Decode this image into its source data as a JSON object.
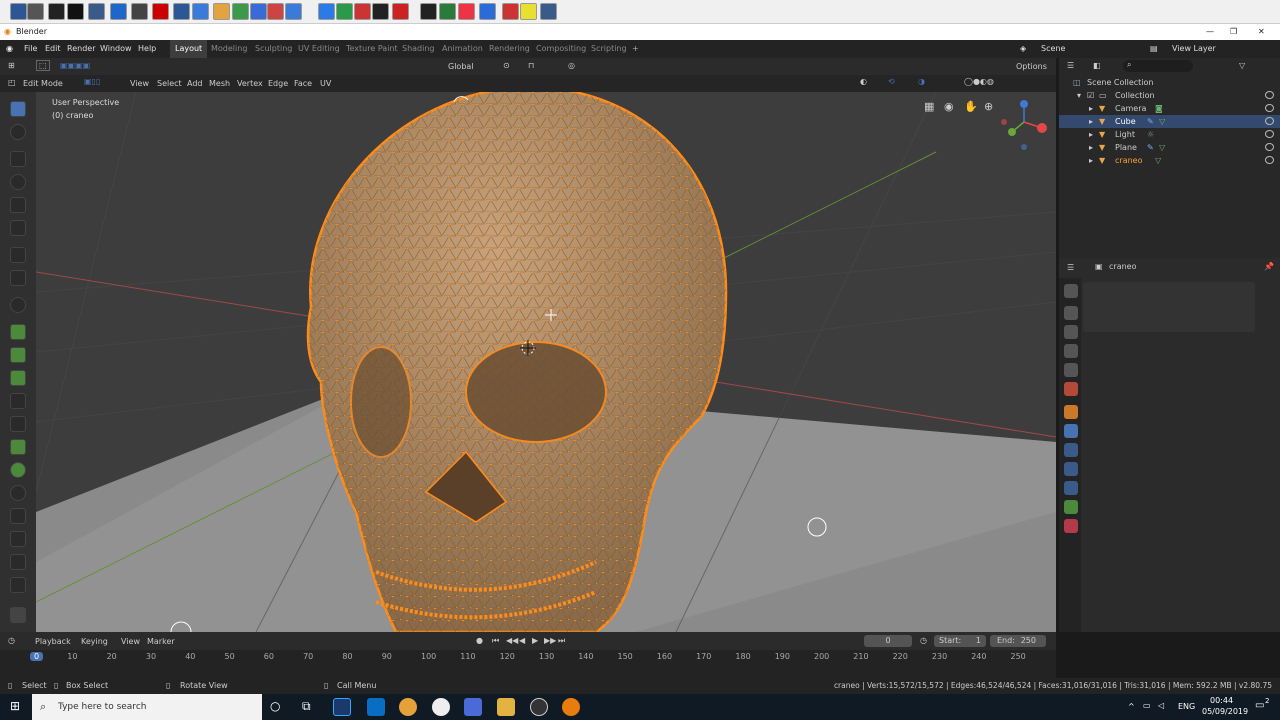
{
  "app": {
    "title": "Blender"
  },
  "menus": [
    "File",
    "Edit",
    "Render",
    "Window",
    "Help"
  ],
  "workspaces": [
    "Layout",
    "Modeling",
    "Sculpting",
    "UV Editing",
    "Texture Paint",
    "Shading",
    "Animation",
    "Rendering",
    "Compositing",
    "Scripting"
  ],
  "header": {
    "scene": "Scene",
    "view_layer": "View Layer",
    "transform": "Global",
    "options": "Options"
  },
  "viewport": {
    "mode": "Edit Mode",
    "menu": [
      "View",
      "Select",
      "Add",
      "Mesh",
      "Vertex",
      "Edge",
      "Face",
      "UV"
    ],
    "overlay_line1": "User Perspective",
    "overlay_line2": "(0) craneo"
  },
  "outliner": {
    "root": "Scene Collection",
    "collection": "Collection",
    "items": [
      {
        "label": "Camera",
        "selected": false,
        "active": false
      },
      {
        "label": "Cube",
        "selected": true,
        "active": false
      },
      {
        "label": "Light",
        "selected": false,
        "active": false
      },
      {
        "label": "Plane",
        "selected": false,
        "active": false
      },
      {
        "label": "craneo",
        "selected": false,
        "active": true
      }
    ]
  },
  "properties": {
    "object_name": "craneo"
  },
  "timeline": {
    "menu": [
      "Playback",
      "Keying",
      "View",
      "Marker"
    ],
    "current_frame": "0",
    "start_label": "Start:",
    "start": "1",
    "end_label": "End:",
    "end": "250",
    "ticks": [
      "0",
      "10",
      "20",
      "30",
      "40",
      "50",
      "60",
      "70",
      "80",
      "90",
      "100",
      "110",
      "120",
      "130",
      "140",
      "150",
      "160",
      "170",
      "180",
      "190",
      "200",
      "210",
      "220",
      "230",
      "240",
      "250"
    ]
  },
  "statusbar": {
    "select": "Select",
    "box_select": "Box Select",
    "rotate": "Rotate View",
    "call_menu": "Call Menu",
    "stats": "craneo | Verts:15,572/15,572 | Edges:46,524/46,524 | Faces:31,016/31,016 | Tris:31,016 | Mem: 592.2 MB | v2.80.75"
  },
  "taskbar": {
    "search_placeholder": "Type here to search",
    "language": "ENG",
    "time": "00:44",
    "date": "05/09/2019",
    "notifications": "2"
  },
  "colors": {
    "accent": "#4772b3",
    "selection": "#ff8c1a",
    "skull": "#b08a5e",
    "workspace_active": "#3d3d3d"
  }
}
